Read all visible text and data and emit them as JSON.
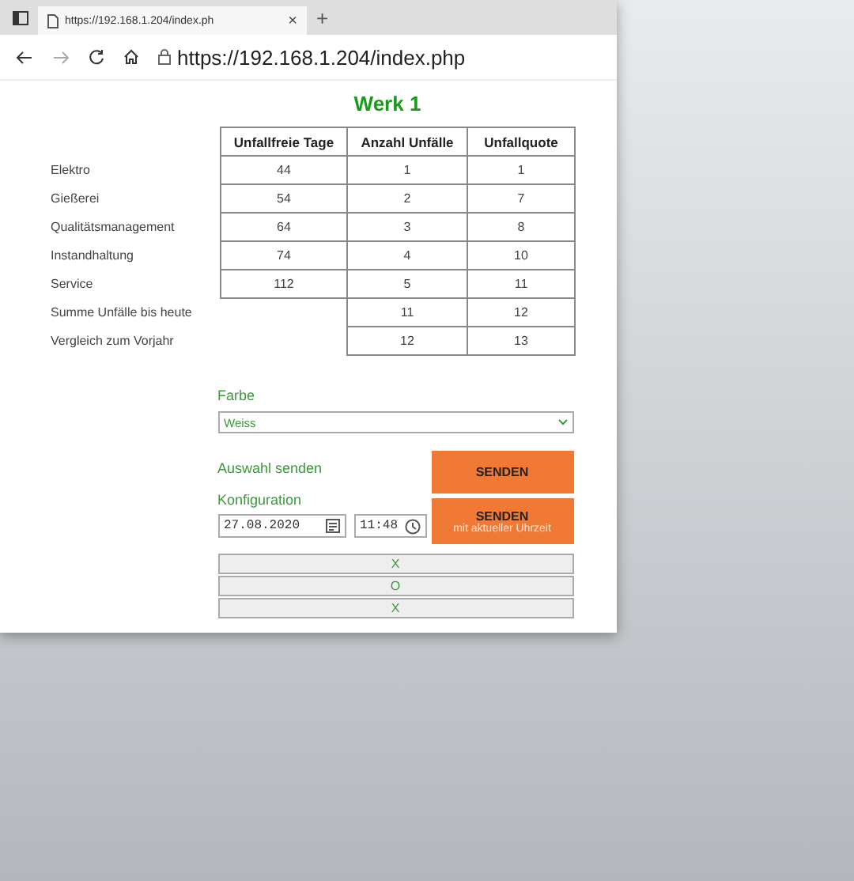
{
  "browser": {
    "tab_title": "https://192.168.1.204/index.ph",
    "new_tab": "+",
    "close": "×",
    "url": "https://192.168.1.204/index.php"
  },
  "heading": "Werk 1",
  "table": {
    "columns": [
      "Unfallfreie Tage",
      "Anzahl Unfälle",
      "Unfallquote"
    ],
    "rows": [
      {
        "label": "Elektro",
        "cells": [
          "44",
          "1",
          "1"
        ]
      },
      {
        "label": "Gießerei",
        "cells": [
          "54",
          "2",
          "7"
        ]
      },
      {
        "label": "Qualitätsmanagement",
        "cells": [
          "64",
          "3",
          "8"
        ]
      },
      {
        "label": "Instandhaltung",
        "cells": [
          "74",
          "4",
          "10"
        ]
      },
      {
        "label": "Service",
        "cells": [
          "112",
          "5",
          "11"
        ]
      },
      {
        "label": "Summe Unfälle bis heute",
        "cells": [
          null,
          "11",
          "12"
        ]
      },
      {
        "label": "Vergleich zum Vorjahr",
        "cells": [
          null,
          "12",
          "13"
        ]
      }
    ]
  },
  "color_label": "Farbe",
  "color_select": {
    "value": "Weiss"
  },
  "send_label": "Auswahl senden",
  "config_label": "Konfiguration",
  "date_field": {
    "value": "27.08.2020"
  },
  "time_field": {
    "value": "11:48"
  },
  "send_button": "SENDEN",
  "send_time_button": {
    "label": "SENDEN",
    "sublabel": "mit aktueller Uhrzeit"
  },
  "bar_buttons": [
    "X",
    "O",
    "X"
  ]
}
